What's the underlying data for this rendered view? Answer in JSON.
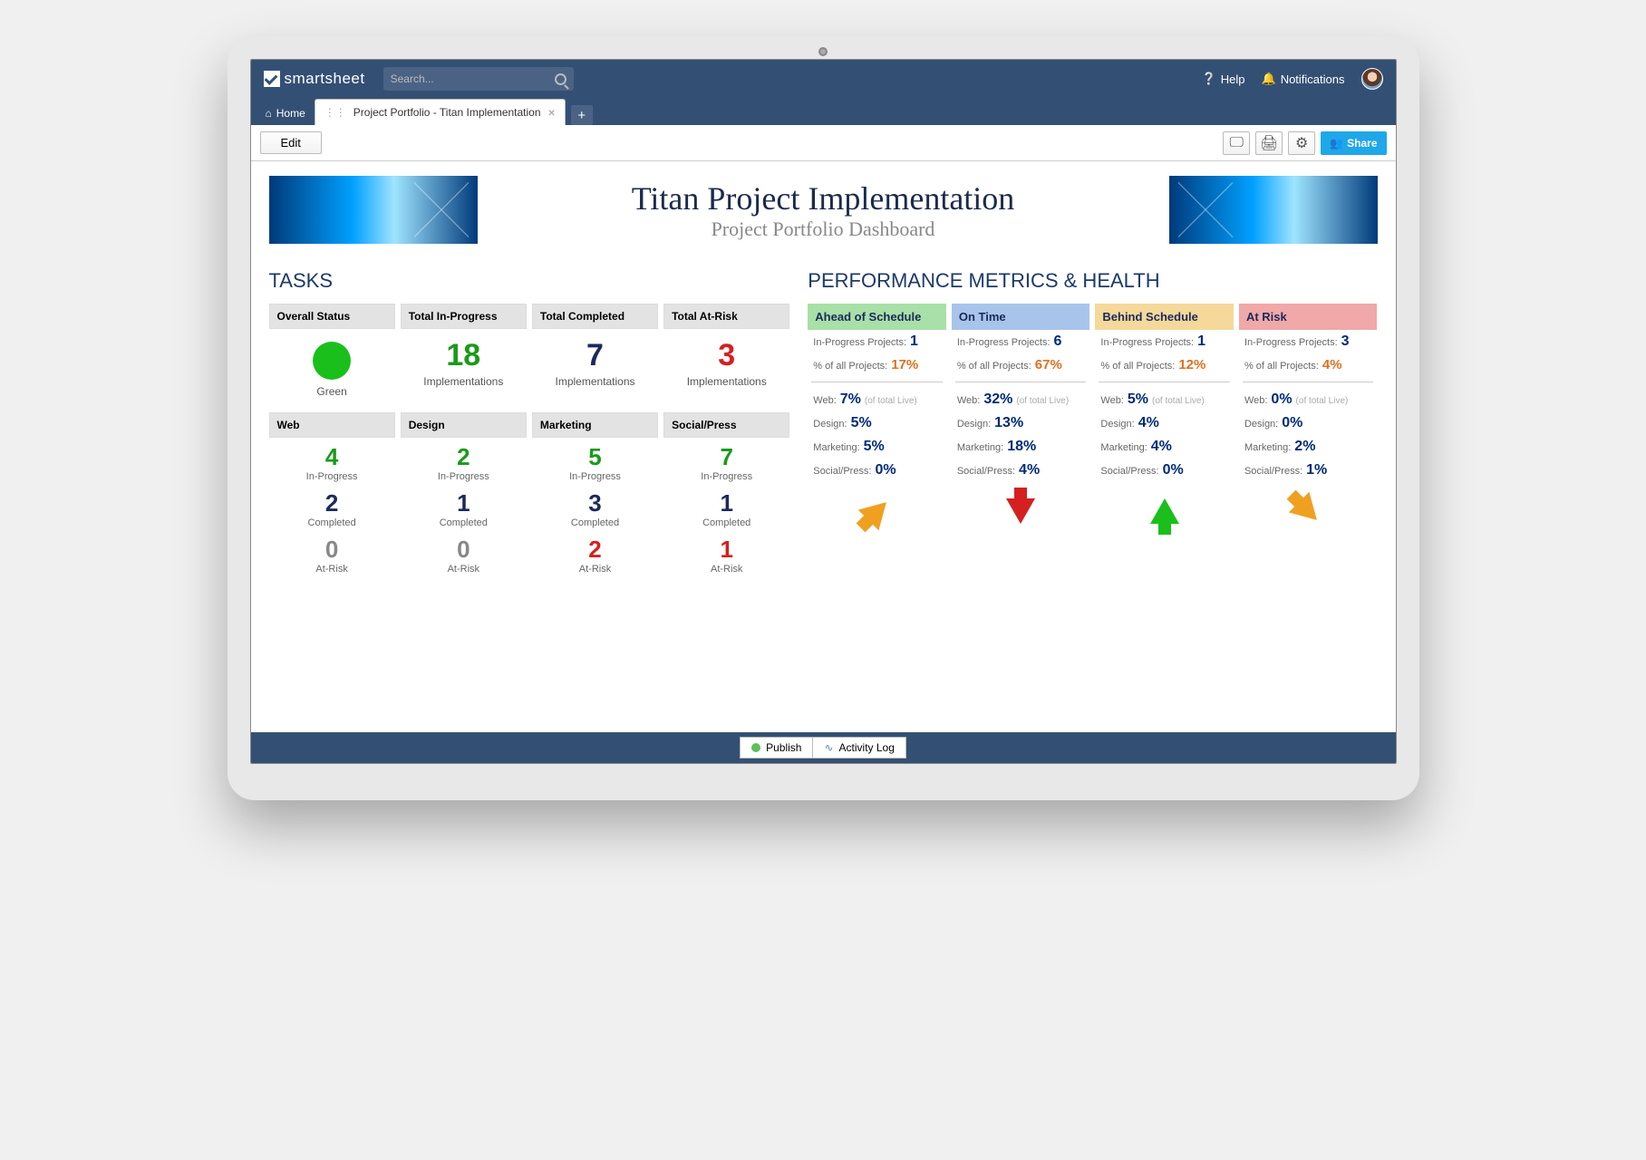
{
  "brand": "smartsheet",
  "search": {
    "placeholder": "Search..."
  },
  "header": {
    "help": "Help",
    "notifications": "Notifications"
  },
  "tabs": {
    "home": "Home",
    "active": "Project Portfolio - Titan Implementation"
  },
  "toolbar": {
    "edit": "Edit",
    "share": "Share"
  },
  "title": {
    "main": "Titan Project Implementation",
    "sub": "Project Portfolio Dashboard"
  },
  "sections": {
    "tasks": "TASKS",
    "perf": "PERFORMANCE METRICS & HEALTH"
  },
  "tasks_top": [
    {
      "head": "Overall Status",
      "label": "Green",
      "kind": "dot"
    },
    {
      "head": "Total In-Progress",
      "num": "18",
      "label": "Implementations",
      "cls": "green"
    },
    {
      "head": "Total Completed",
      "num": "7",
      "label": "Implementations",
      "cls": "navy"
    },
    {
      "head": "Total At-Risk",
      "num": "3",
      "label": "Implementations",
      "cls": "red"
    }
  ],
  "tasks_bottom": [
    {
      "head": "Web",
      "rows": [
        {
          "n": "4",
          "l": "In-Progress",
          "c": "green"
        },
        {
          "n": "2",
          "l": "Completed",
          "c": "navy"
        },
        {
          "n": "0",
          "l": "At-Risk",
          "c": "grey"
        }
      ]
    },
    {
      "head": "Design",
      "rows": [
        {
          "n": "2",
          "l": "In-Progress",
          "c": "green"
        },
        {
          "n": "1",
          "l": "Completed",
          "c": "navy"
        },
        {
          "n": "0",
          "l": "At-Risk",
          "c": "grey"
        }
      ]
    },
    {
      "head": "Marketing",
      "rows": [
        {
          "n": "5",
          "l": "In-Progress",
          "c": "green"
        },
        {
          "n": "3",
          "l": "Completed",
          "c": "navy"
        },
        {
          "n": "2",
          "l": "At-Risk",
          "c": "red"
        }
      ]
    },
    {
      "head": "Social/Press",
      "rows": [
        {
          "n": "7",
          "l": "In-Progress",
          "c": "green"
        },
        {
          "n": "1",
          "l": "Completed",
          "c": "navy"
        },
        {
          "n": "1",
          "l": "At-Risk",
          "c": "red"
        }
      ]
    }
  ],
  "perf_labels": {
    "inprog": "In-Progress Projects:",
    "pct": "% of all Projects:",
    "web": "Web:",
    "design": "Design:",
    "marketing": "Marketing:",
    "social": "Social/Press:",
    "hint": "(of total Live)"
  },
  "perf_cols": [
    {
      "head": "Ahead of Schedule",
      "hcls": "ph-green",
      "inprog": "1",
      "pct": "17%",
      "web": "7%",
      "design": "5%",
      "marketing": "5%",
      "social": "0%",
      "arrow": "up diag c-orange"
    },
    {
      "head": "On Time",
      "hcls": "ph-blue",
      "inprog": "6",
      "pct": "67%",
      "web": "32%",
      "design": "13%",
      "marketing": "18%",
      "social": "4%",
      "arrow": "down c-red"
    },
    {
      "head": "Behind Schedule",
      "hcls": "ph-yellow",
      "inprog": "1",
      "pct": "12%",
      "web": "5%",
      "design": "4%",
      "marketing": "4%",
      "social": "0%",
      "arrow": "up c-green"
    },
    {
      "head": "At Risk",
      "hcls": "ph-red",
      "inprog": "3",
      "pct": "4%",
      "web": "0%",
      "design": "0%",
      "marketing": "2%",
      "social": "1%",
      "arrow": "up diagdown c-orange"
    }
  ],
  "footer": {
    "publish": "Publish",
    "activity": "Activity Log"
  }
}
